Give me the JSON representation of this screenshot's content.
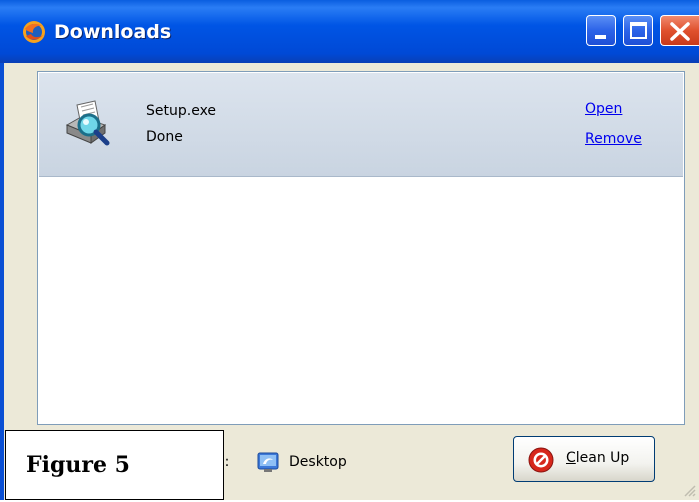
{
  "window": {
    "title": "Downloads",
    "icon": "firefox-icon",
    "controls": [
      "minimize-icon",
      "maximize-icon",
      "close-icon"
    ]
  },
  "downloads": [
    {
      "file_name": "Setup.exe",
      "status": "Done",
      "icon": "installer-magnifier-icon",
      "actions": {
        "open_label": "Open",
        "remove_label": "Remove"
      }
    }
  ],
  "footer": {
    "save_to_label_visible": "o:",
    "location": "Desktop",
    "location_icon": "desktop-icon",
    "cleanup_label_first": "C",
    "cleanup_label_rest": "lean Up",
    "cleanup_icon": "no-entry-icon"
  },
  "caption": {
    "label": "Figure 5"
  },
  "colors": {
    "titlebar": "#0055e5",
    "link": "#0000ee",
    "item_background": "#cfd9e6",
    "close_button": "#e0512e"
  }
}
